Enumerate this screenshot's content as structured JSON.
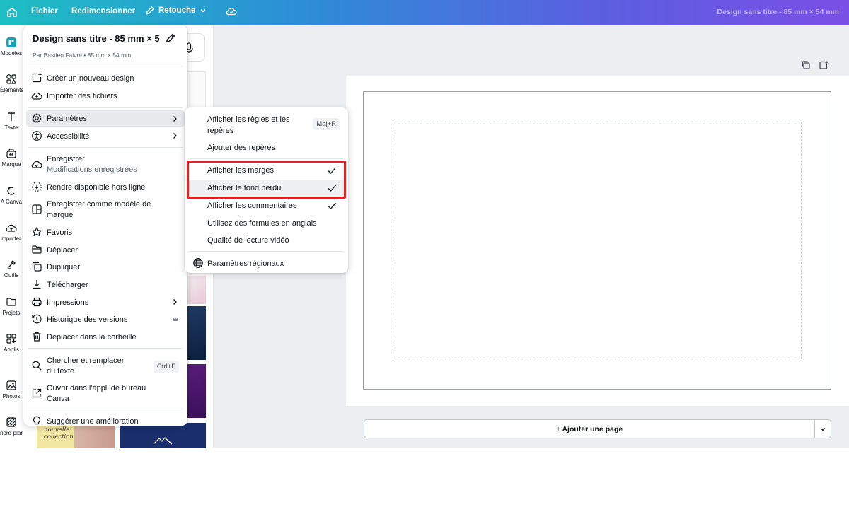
{
  "topbar": {
    "file": "Fichier",
    "resize": "Redimensionner",
    "retouche": "Retouche",
    "doc_title": "Design sans titre - 85 mm × 54 mm"
  },
  "rail": [
    {
      "label": "Modèles",
      "icon": "templates-icon"
    },
    {
      "label": "Éléments",
      "icon": "elements-icon"
    },
    {
      "label": "Texte",
      "icon": "text-icon"
    },
    {
      "label": "Marque",
      "icon": "brand-icon"
    },
    {
      "label": "A Canva",
      "icon": "magic-icon"
    },
    {
      "label": "mporter",
      "icon": "upload-icon"
    },
    {
      "label": "Outils",
      "icon": "tools-icon"
    },
    {
      "label": "Projets",
      "icon": "folder-icon"
    },
    {
      "label": "Applis",
      "icon": "apps-icon"
    },
    {
      "label": "Photos",
      "icon": "photo-icon"
    },
    {
      "label": "rière-plan",
      "icon": "background-icon"
    }
  ],
  "thumbs": {
    "collection_text": "nouvelle collection"
  },
  "menu": {
    "title": "Design sans titre - 85 mm × 5",
    "subtitle": "Par Bastien Faivre • 85 mm × 54 mm",
    "items": {
      "create": "Créer un nouveau design",
      "import": "Importer des fichiers",
      "settings": "Paramètres",
      "accessibility": "Accessibilité",
      "save": "Enregistrer",
      "save_status": "Modifications enregistrées",
      "offline": "Rendre disponible hors ligne",
      "save_template_1": "Enregistrer comme modèle de",
      "save_template_2": "marque",
      "favorites": "Favoris",
      "move": "Déplacer",
      "duplicate": "Dupliquer",
      "download": "Télécharger",
      "print": "Impressions",
      "history": "Historique des versions",
      "trash": "Déplacer dans la corbeille",
      "find_1": "Chercher et remplacer",
      "find_2": "du texte",
      "find_shortcut": "Ctrl+F",
      "desktop_1": "Ouvrir dans l'appli de bureau",
      "desktop_2": "Canva",
      "suggest": "Suggérer une amélioration"
    }
  },
  "submenu": {
    "rulers_1": "Afficher les règles et les",
    "rulers_2": "repères",
    "rulers_shortcut": "Maj+R",
    "add_guides": "Ajouter des repères",
    "margins": "Afficher les marges",
    "bleed": "Afficher le fond perdu",
    "comments": "Afficher les commentaires",
    "formulas": "Utilisez des formules en anglais",
    "video_quality": "Qualité de lecture vidéo",
    "regional": "Paramètres régionaux"
  },
  "canvas": {
    "add_page": "+ Ajouter une page"
  },
  "colors": {
    "highlight": "#e02424",
    "accent_start": "#1ebfc4",
    "accent_end": "#7a4fe6"
  }
}
